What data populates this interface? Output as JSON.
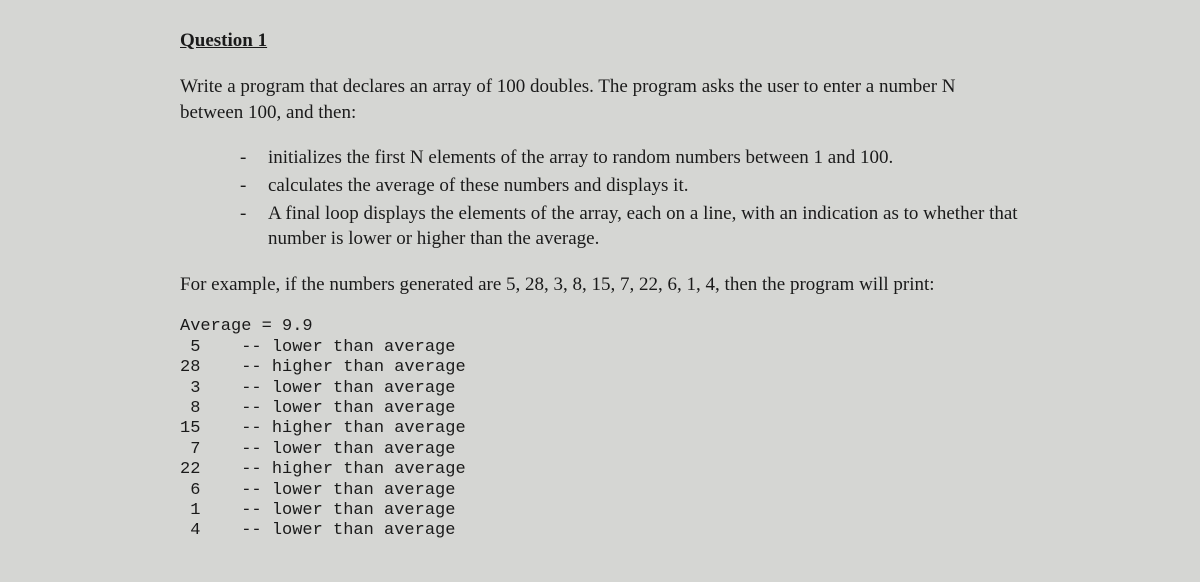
{
  "title": "Question 1",
  "intro": "Write a program that declares an array of 100 doubles. The program asks the user to enter a number N between 100, and then:",
  "bullets": [
    "initializes the first N elements of the array to random numbers between 1 and 100.",
    "calculates the average of these numbers and displays it.",
    "A final loop displays the elements of the array, each on a line, with an indication as to whether that number is lower or higher than the average."
  ],
  "example_intro": "For example, if the numbers generated are  5, 28, 3, 8, 15, 7, 22, 6, 1, 4,  then the program will print:",
  "output": {
    "average_line": "Average = 9.9",
    "rows": [
      {
        "num": " 5",
        "note": "-- lower than average"
      },
      {
        "num": "28",
        "note": "-- higher than average"
      },
      {
        "num": " 3",
        "note": "-- lower than average"
      },
      {
        "num": " 8",
        "note": "-- lower than average"
      },
      {
        "num": "15",
        "note": "-- higher than average"
      },
      {
        "num": " 7",
        "note": "-- lower than average"
      },
      {
        "num": "22",
        "note": "-- higher than average"
      },
      {
        "num": " 6",
        "note": "-- lower than average"
      },
      {
        "num": " 1",
        "note": "-- lower than average"
      },
      {
        "num": " 4",
        "note": "-- lower than average"
      }
    ]
  }
}
